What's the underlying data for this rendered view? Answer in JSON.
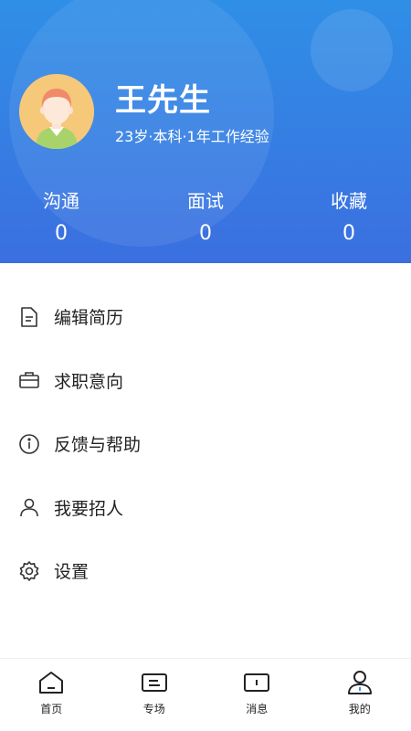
{
  "profile": {
    "name": "王先生",
    "subtitle": "23岁·本科·1年工作经验",
    "avatar_icon": "person-avatar-icon"
  },
  "stats": [
    {
      "label": "沟通",
      "value": "0"
    },
    {
      "label": "面试",
      "value": "0"
    },
    {
      "label": "收藏",
      "value": "0"
    }
  ],
  "menu": [
    {
      "label": "编辑简历",
      "icon": "document-icon"
    },
    {
      "label": "求职意向",
      "icon": "briefcase-icon"
    },
    {
      "label": "反馈与帮助",
      "icon": "info-icon"
    },
    {
      "label": "我要招人",
      "icon": "person-icon"
    },
    {
      "label": "设置",
      "icon": "gear-icon"
    }
  ],
  "tabbar": [
    {
      "label": "首页",
      "icon": "home-icon",
      "active": false
    },
    {
      "label": "专场",
      "icon": "card-icon",
      "active": false
    },
    {
      "label": "消息",
      "icon": "message-icon",
      "active": false
    },
    {
      "label": "我的",
      "icon": "user-icon",
      "active": true
    }
  ],
  "colors": {
    "header_top": "#2f8fe6",
    "header_bottom": "#3b6fe0",
    "accent": "#3b8cf0"
  }
}
